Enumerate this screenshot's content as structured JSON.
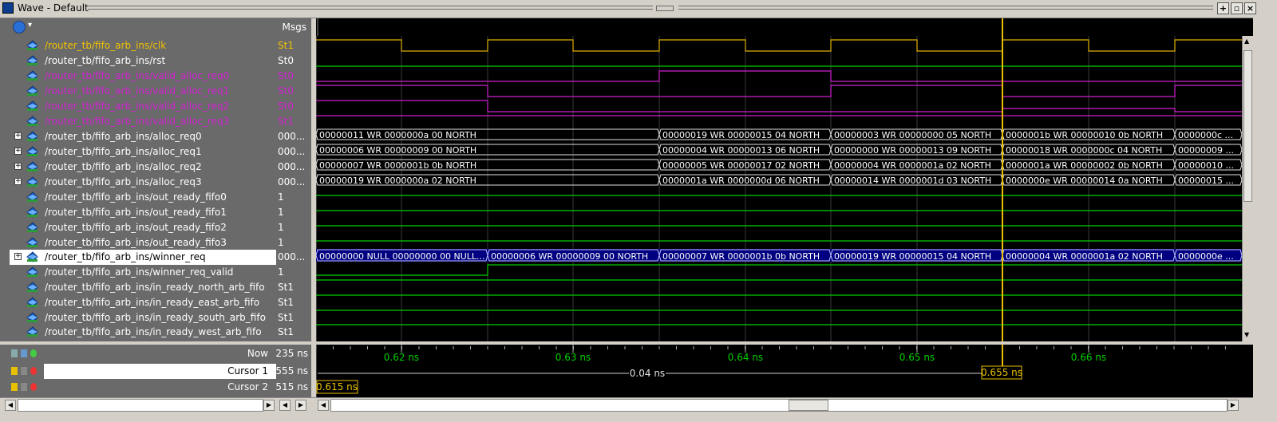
{
  "window": {
    "title": "Wave - Default"
  },
  "header": {
    "msgs_label": "Msgs"
  },
  "colors": {
    "clock": "#e0b000",
    "yellow_text": "#f0c000",
    "magenta": "#d020d0",
    "green": "#00d000",
    "bus": "#e0e0e0",
    "cursor": "#e8c000",
    "winner_highlight": "#000080"
  },
  "signals": [
    {
      "name": "/router_tb/fifo_arb_ins/clk",
      "msg": "St1",
      "color": "yellow",
      "expandable": false
    },
    {
      "name": "/router_tb/fifo_arb_ins/rst",
      "msg": "St0",
      "color": "white",
      "expandable": false
    },
    {
      "name": "/router_tb/fifo_arb_ins/valid_alloc_req0",
      "msg": "St0",
      "color": "magenta",
      "expandable": false
    },
    {
      "name": "/router_tb/fifo_arb_ins/valid_alloc_req1",
      "msg": "St0",
      "color": "magenta",
      "expandable": false
    },
    {
      "name": "/router_tb/fifo_arb_ins/valid_alloc_req2",
      "msg": "St0",
      "color": "magenta",
      "expandable": false
    },
    {
      "name": "/router_tb/fifo_arb_ins/valid_alloc_req3",
      "msg": "St1",
      "color": "magenta",
      "expandable": false
    },
    {
      "name": "/router_tb/fifo_arb_ins/alloc_req0",
      "msg": "000...",
      "color": "white",
      "expandable": true
    },
    {
      "name": "/router_tb/fifo_arb_ins/alloc_req1",
      "msg": "000...",
      "color": "white",
      "expandable": true
    },
    {
      "name": "/router_tb/fifo_arb_ins/alloc_req2",
      "msg": "000...",
      "color": "white",
      "expandable": true
    },
    {
      "name": "/router_tb/fifo_arb_ins/alloc_req3",
      "msg": "000...",
      "color": "white",
      "expandable": true
    },
    {
      "name": "/router_tb/fifo_arb_ins/out_ready_fifo0",
      "msg": "1",
      "color": "white",
      "expandable": false
    },
    {
      "name": "/router_tb/fifo_arb_ins/out_ready_fifo1",
      "msg": "1",
      "color": "white",
      "expandable": false
    },
    {
      "name": "/router_tb/fifo_arb_ins/out_ready_fifo2",
      "msg": "1",
      "color": "white",
      "expandable": false
    },
    {
      "name": "/router_tb/fifo_arb_ins/out_ready_fifo3",
      "msg": "1",
      "color": "white",
      "expandable": false
    },
    {
      "name": "/router_tb/fifo_arb_ins/winner_req",
      "msg": "000...",
      "color": "black",
      "expandable": true,
      "selected": true
    },
    {
      "name": "/router_tb/fifo_arb_ins/winner_req_valid",
      "msg": "1",
      "color": "white",
      "expandable": false
    },
    {
      "name": "/router_tb/fifo_arb_ins/in_ready_north_arb_fifo",
      "msg": "St1",
      "color": "white",
      "expandable": false
    },
    {
      "name": "/router_tb/fifo_arb_ins/in_ready_east_arb_fifo",
      "msg": "St1",
      "color": "white",
      "expandable": false
    },
    {
      "name": "/router_tb/fifo_arb_ins/in_ready_south_arb_fifo",
      "msg": "St1",
      "color": "white",
      "expandable": false
    },
    {
      "name": "/router_tb/fifo_arb_ins/in_ready_west_arb_fifo",
      "msg": "St1",
      "color": "white",
      "expandable": false
    }
  ],
  "buses": {
    "alloc_req0": [
      "00000011 WR 0000000a 00 NORTH",
      "00000019 WR 00000015 04 NORTH",
      "00000003 WR 00000000 05 NORTH",
      "0000001b WR 00000010 0b NORTH",
      "0000000c ..."
    ],
    "alloc_req1": [
      "00000006 WR 00000009 00 NORTH",
      "00000004 WR 00000013 06 NORTH",
      "00000000 WR 00000013 09 NORTH",
      "00000018 WR 0000000c 04 NORTH",
      "00000009 ..."
    ],
    "alloc_req2": [
      "00000007 WR 0000001b 0b NORTH",
      "00000005 WR 00000017 02 NORTH",
      "00000004 WR 0000001a 02 NORTH",
      "0000001a WR 00000002 0b NORTH",
      "00000010 ..."
    ],
    "alloc_req3": [
      "00000019 WR 0000000a 02 NORTH",
      "0000001a WR 0000000d 06 NORTH",
      "00000014 WR 0000001d 03 NORTH",
      "0000000e WR 00000014 0a NORTH",
      "00000015 ..."
    ],
    "winner_req": [
      "00000000 NULL 00000000 00 NULL...",
      "00000006 WR 00000009 00 NORTH",
      "00000007 WR 0000001b 0b NORTH",
      "00000019 WR 00000015 04 NORTH",
      "00000004 WR 0000001a 02 NORTH",
      "0000000e ..."
    ]
  },
  "timeline": {
    "tick_labels": [
      "0.62 ns",
      "0.63 ns",
      "0.64 ns",
      "0.65 ns",
      "0.66 ns"
    ],
    "delta_label": "0.04 ns",
    "cursor1_label": "0.655 ns",
    "cursor2_label": "0.615 ns"
  },
  "cursors": [
    {
      "name": "Now",
      "value": "235 ns"
    },
    {
      "name": "Cursor 1",
      "value": "555 ns"
    },
    {
      "name": "Cursor 2",
      "value": "515 ns"
    }
  ]
}
